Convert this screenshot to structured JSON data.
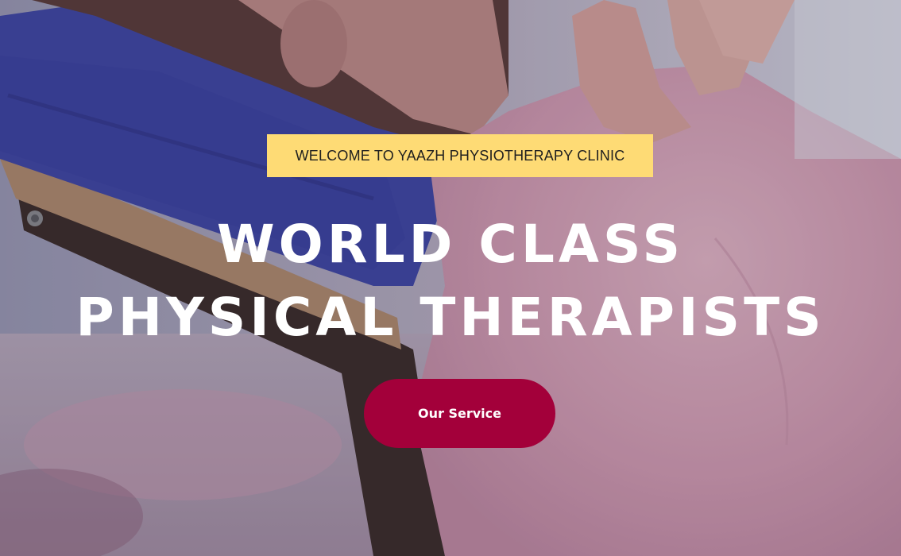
{
  "colors": {
    "tagline_bg": "#fedb75",
    "tagline_text": "#1f1f1f",
    "headline_text": "#ffffff",
    "cta_bg": "#a3003a",
    "cta_text": "#ffffff"
  },
  "hero": {
    "background_image": "massage-therapy-photo",
    "tagline": "WELCOME TO YAAZH PHYSIOTHERAPY CLINIC",
    "headline": {
      "line1": "WORLD CLASS",
      "line2": "PHYSICAL THERAPISTS"
    },
    "cta_label": "Our Service"
  }
}
